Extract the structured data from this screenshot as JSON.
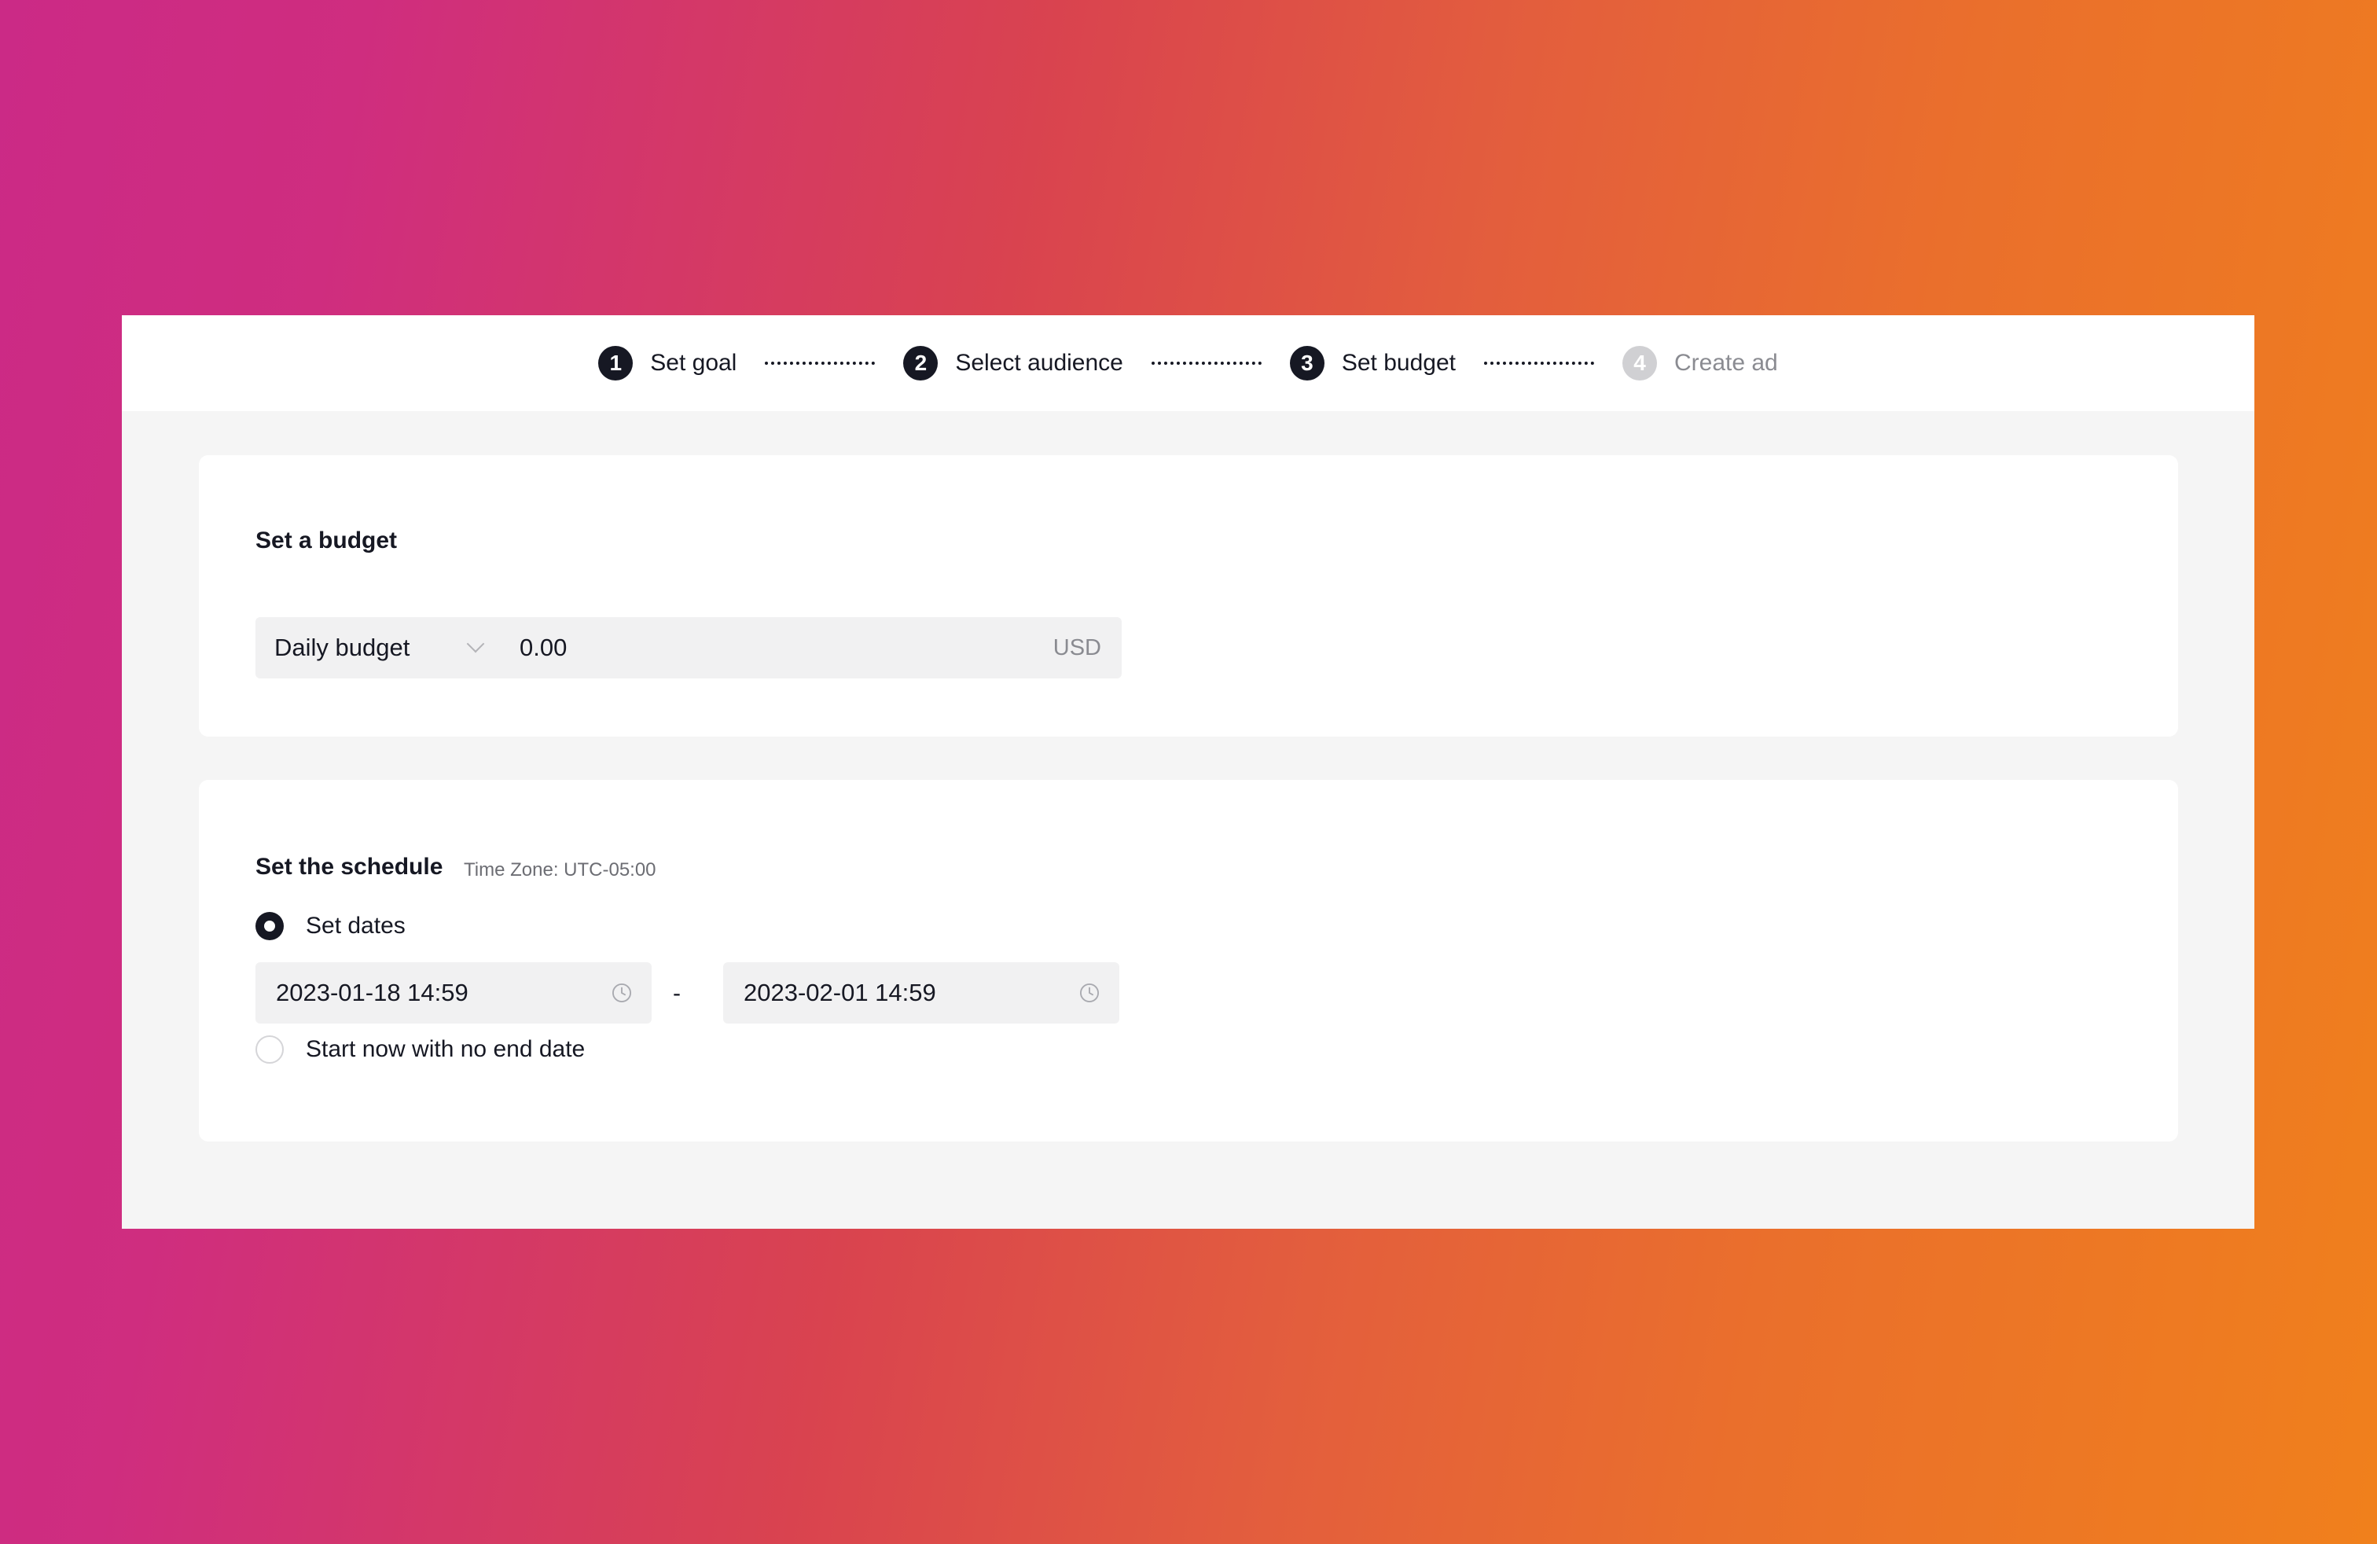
{
  "stepper": {
    "steps": [
      {
        "number": "1",
        "label": "Set goal"
      },
      {
        "number": "2",
        "label": "Select audience"
      },
      {
        "number": "3",
        "label": "Set budget"
      },
      {
        "number": "4",
        "label": "Create ad"
      }
    ]
  },
  "budget": {
    "title": "Set a budget",
    "type_selected": "Daily budget",
    "amount": "0.00",
    "currency": "USD"
  },
  "schedule": {
    "title": "Set the schedule",
    "timezone": "Time Zone: UTC-05:00",
    "option_set_dates": "Set dates",
    "option_set_dates_selected": true,
    "start": "2023-01-18 14:59",
    "separator": "-",
    "end": "2023-02-01 14:59",
    "option_start_now": "Start now with no end date",
    "option_start_now_selected": false
  },
  "colors": {
    "active_step": "#161823",
    "inactive_step": "#d0d0d3",
    "gradient_start": "#cb2a86",
    "gradient_end": "#f0801c"
  },
  "icons": {
    "dropdown": "chevron-down-icon",
    "datetime": "clock-icon"
  }
}
